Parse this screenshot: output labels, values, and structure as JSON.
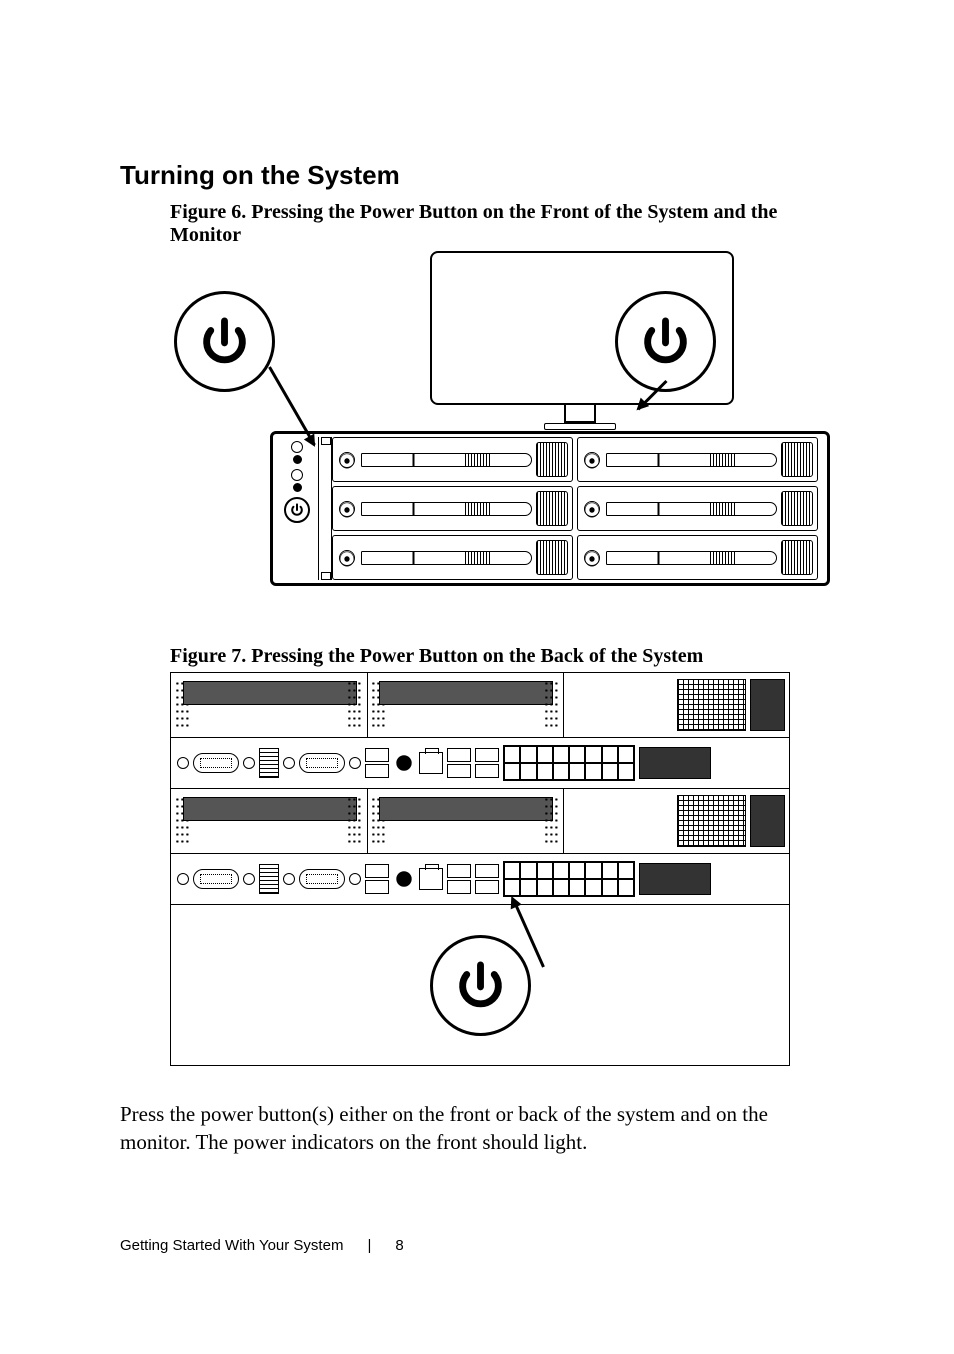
{
  "section": {
    "heading": "Turning on the System"
  },
  "figures": {
    "fig6": {
      "caption": "Figure 6. Pressing the Power Button on the Front of the System and the Monitor"
    },
    "fig7": {
      "caption": "Figure 7. Pressing the Power Button on the Back of the System"
    }
  },
  "body": {
    "paragraph": "Press the power button(s) either on the front or back of the system and on the monitor. The power indicators on the front should light."
  },
  "icons": {
    "power_callout": "power-icon",
    "drive_handle": "drive-handle-icon",
    "chassis_power": "power-button-icon"
  },
  "footer": {
    "section_label": "Getting Started With Your System",
    "page_number": "8"
  }
}
